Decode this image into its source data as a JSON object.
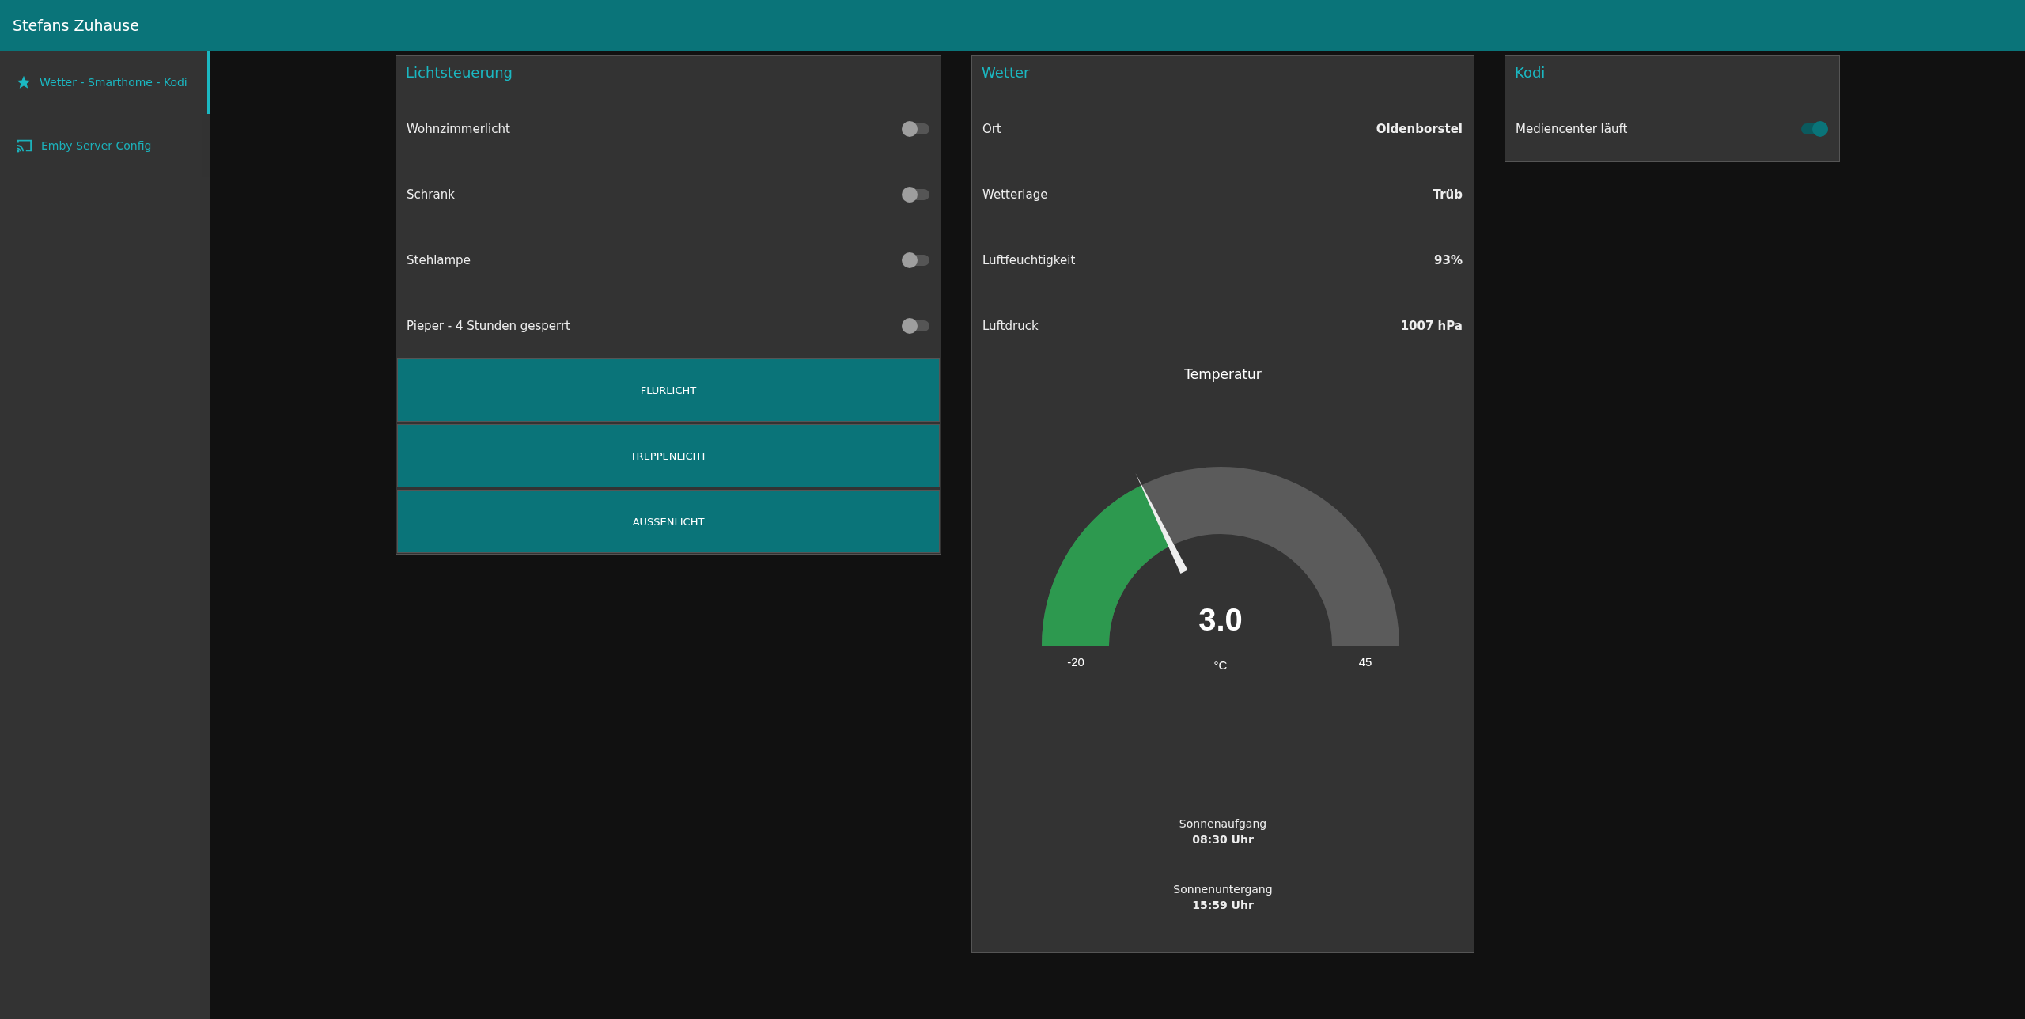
{
  "header": {
    "title": "Stefans Zuhause"
  },
  "sidebar": {
    "items": [
      {
        "label": "Wetter - Smarthome - Kodi",
        "selected": true
      },
      {
        "label": "Emby Server Config",
        "selected": false
      }
    ]
  },
  "lichtsteuerung": {
    "title": "Lichtsteuerung",
    "switches": [
      {
        "label": "Wohnzimmerlicht",
        "on": false
      },
      {
        "label": "Schrank",
        "on": false
      },
      {
        "label": "Stehlampe",
        "on": false
      },
      {
        "label": "Pieper - 4 Stunden gesperrt",
        "on": false
      }
    ],
    "buttons": [
      "FLURLICHT",
      "TREPPENLICHT",
      "AUSSENLICHT"
    ]
  },
  "wetter": {
    "title": "Wetter",
    "rows": [
      {
        "label": "Ort",
        "value": "Oldenborstel"
      },
      {
        "label": "Wetterlage",
        "value": "Trüb"
      },
      {
        "label": "Luftfeuchtigkeit",
        "value": "93%"
      },
      {
        "label": "Luftdruck",
        "value": "1007 hPa"
      }
    ],
    "gauge": {
      "title": "Temperatur",
      "value": "3.0",
      "unit": "°C",
      "min": "-20",
      "max": "45",
      "level": 0.354
    },
    "sun": [
      {
        "label": "Sonnenaufgang",
        "time": "08:30 Uhr"
      },
      {
        "label": "Sonnenuntergang",
        "time": "15:59 Uhr"
      }
    ]
  },
  "kodi": {
    "title": "Kodi",
    "switches": [
      {
        "label": "Mediencenter läuft",
        "on": true
      }
    ]
  }
}
